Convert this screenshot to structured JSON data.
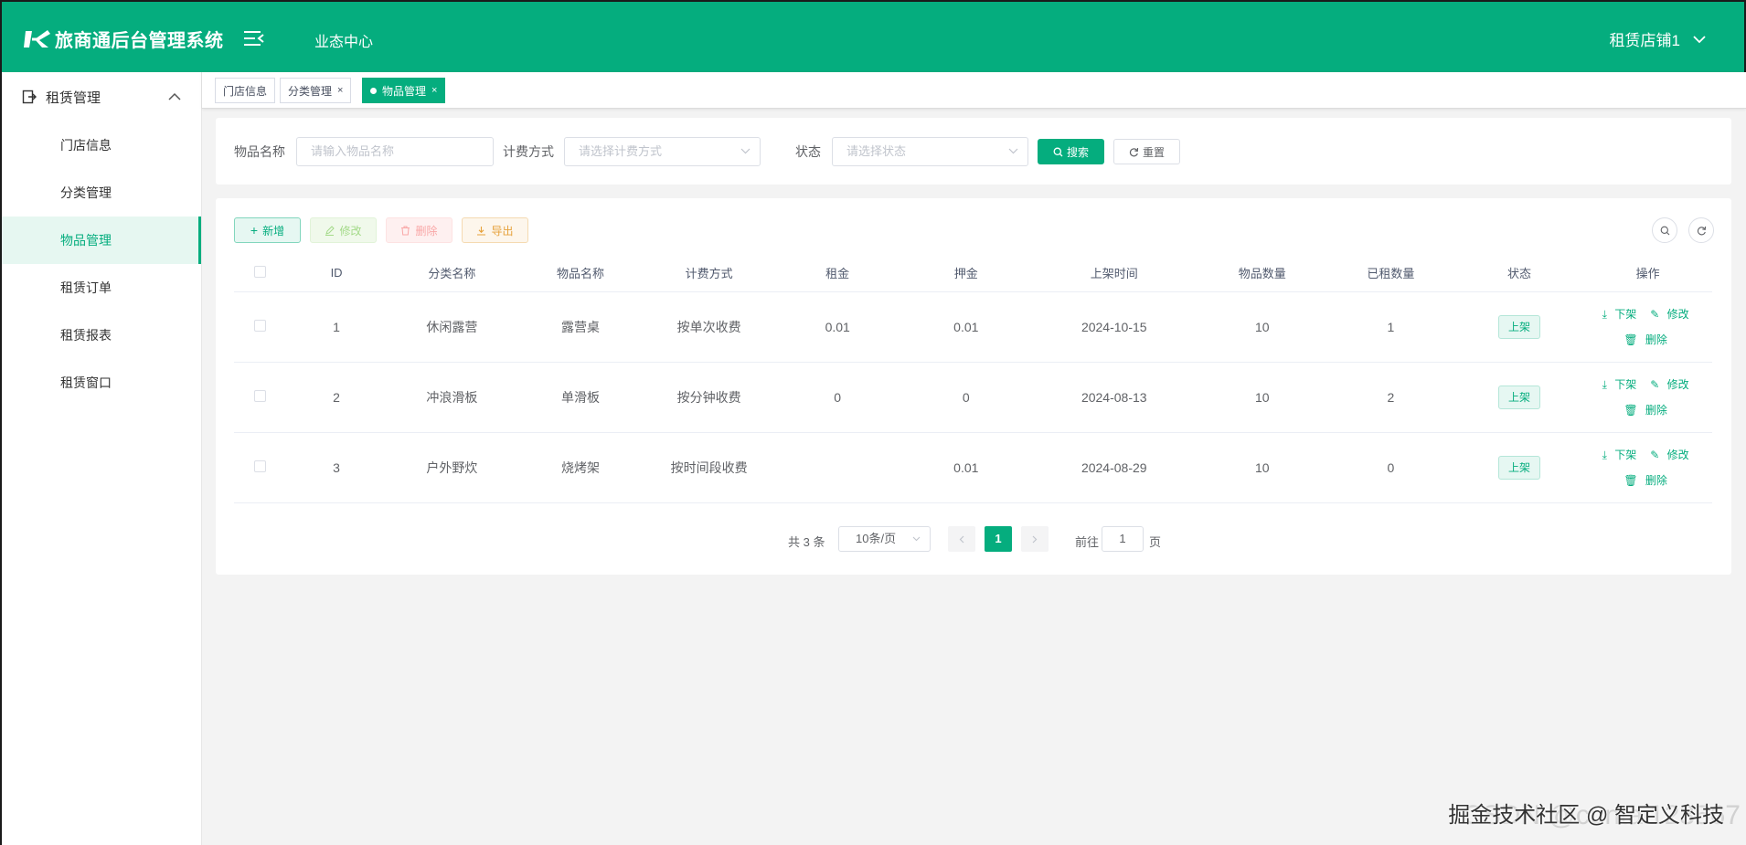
{
  "header": {
    "app_title": "旅商通后台管理系统",
    "biz_center": "业态中心",
    "store_name": "租赁店铺1"
  },
  "sidebar": {
    "group_label": "租赁管理",
    "items": [
      {
        "label": "门店信息",
        "active": false
      },
      {
        "label": "分类管理",
        "active": false
      },
      {
        "label": "物品管理",
        "active": true
      },
      {
        "label": "租赁订单",
        "active": false
      },
      {
        "label": "租赁报表",
        "active": false
      },
      {
        "label": "租赁窗口",
        "active": false
      }
    ]
  },
  "tabs": [
    {
      "label": "门店信息"
    },
    {
      "label": "分类管理",
      "close": "×"
    },
    {
      "label": "物品管理",
      "close": "×",
      "active": true
    }
  ],
  "search": {
    "name_label": "物品名称",
    "name_placeholder": "请输入物品名称",
    "billing_label": "计费方式",
    "billing_placeholder": "请选择计费方式",
    "status_label": "状态",
    "status_placeholder": "请选择状态",
    "search_button": "搜索",
    "reset_button": "重置"
  },
  "toolbar": {
    "add": "新增",
    "edit": "修改",
    "delete": "删除",
    "export": "导出"
  },
  "table": {
    "columns": [
      "ID",
      "分类名称",
      "物品名称",
      "计费方式",
      "租金",
      "押金",
      "上架时间",
      "物品数量",
      "已租数量",
      "状态",
      "操作"
    ],
    "rows": [
      {
        "id": "1",
        "category": "休闲露营",
        "name": "露营桌",
        "billing": "按单次收费",
        "rent": "0.01",
        "deposit": "0.01",
        "listed": "2024-10-15",
        "qty": "10",
        "rented": "1",
        "status": "上架"
      },
      {
        "id": "2",
        "category": "冲浪滑板",
        "name": "单滑板",
        "billing": "按分钟收费",
        "rent": "0",
        "deposit": "0",
        "listed": "2024-08-13",
        "qty": "10",
        "rented": "2",
        "status": "上架"
      },
      {
        "id": "3",
        "category": "户外野炊",
        "name": "烧烤架",
        "billing": "按时间段收费",
        "rent": "",
        "deposit": "0.01",
        "listed": "2024-08-29",
        "qty": "10",
        "rented": "0",
        "status": "上架"
      }
    ],
    "op_off": "下架",
    "op_edit": "修改",
    "op_delete": "删除"
  },
  "pagination": {
    "total": "共 3 条",
    "page_size": "10条/页",
    "current_page": "1",
    "goto_label": "前往",
    "goto_value": "1",
    "page_suffix": "页"
  },
  "watermark": {
    "front": "掘金技术社区 @ 智定义科技",
    "back": "CSDN @cuntai123567"
  },
  "colors": {
    "brand": "#05ad7e"
  }
}
